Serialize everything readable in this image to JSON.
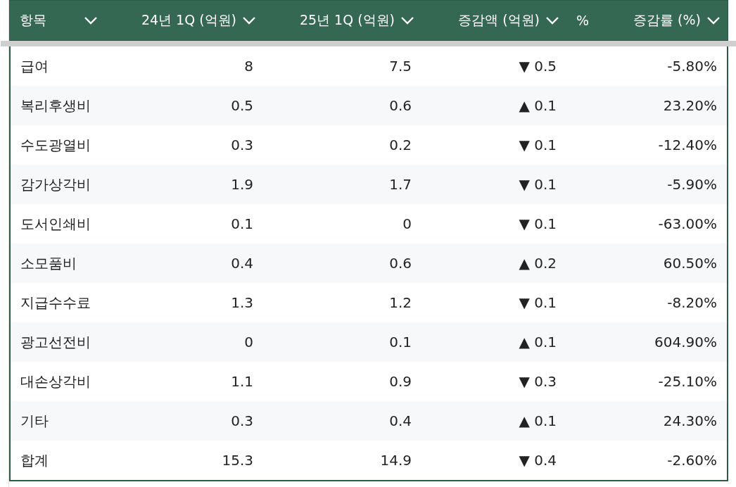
{
  "table": {
    "columns": [
      {
        "label": "항목"
      },
      {
        "label": "24년 1Q (억원)"
      },
      {
        "label": "25년 1Q (억원)"
      },
      {
        "label": "증감액 (억원)"
      },
      {
        "label": "증감률 (%)",
        "prefix": "%"
      }
    ],
    "rows": [
      {
        "cells": [
          "급여",
          "8",
          "7.5",
          "▼ 0.5",
          "-5.80%"
        ]
      },
      {
        "cells": [
          "복리후생비",
          "0.5",
          "0.6",
          "▲ 0.1",
          "23.20%"
        ]
      },
      {
        "cells": [
          "수도광열비",
          "0.3",
          "0.2",
          "▼ 0.1",
          "-12.40%"
        ]
      },
      {
        "cells": [
          "감가상각비",
          "1.9",
          "1.7",
          "▼ 0.1",
          "-5.90%"
        ]
      },
      {
        "cells": [
          "도서인쇄비",
          "0.1",
          "0",
          "▼ 0.1",
          "-63.00%"
        ]
      },
      {
        "cells": [
          "소모품비",
          "0.4",
          "0.6",
          "▲ 0.2",
          "60.50%"
        ]
      },
      {
        "cells": [
          "지급수수료",
          "1.3",
          "1.2",
          "▼ 0.1",
          "-8.20%"
        ]
      },
      {
        "cells": [
          "광고선전비",
          "0",
          "0.1",
          "▲ 0.1",
          "604.90%"
        ]
      },
      {
        "cells": [
          "대손상각비",
          "1.1",
          "0.9",
          "▼ 0.3",
          "-25.10%"
        ]
      },
      {
        "cells": [
          "기타",
          "0.3",
          "0.4",
          "▲ 0.1",
          "24.30%"
        ]
      },
      {
        "cells": [
          "합계",
          "15.3",
          "14.9",
          "▼ 0.4",
          "-2.60%"
        ]
      }
    ]
  }
}
